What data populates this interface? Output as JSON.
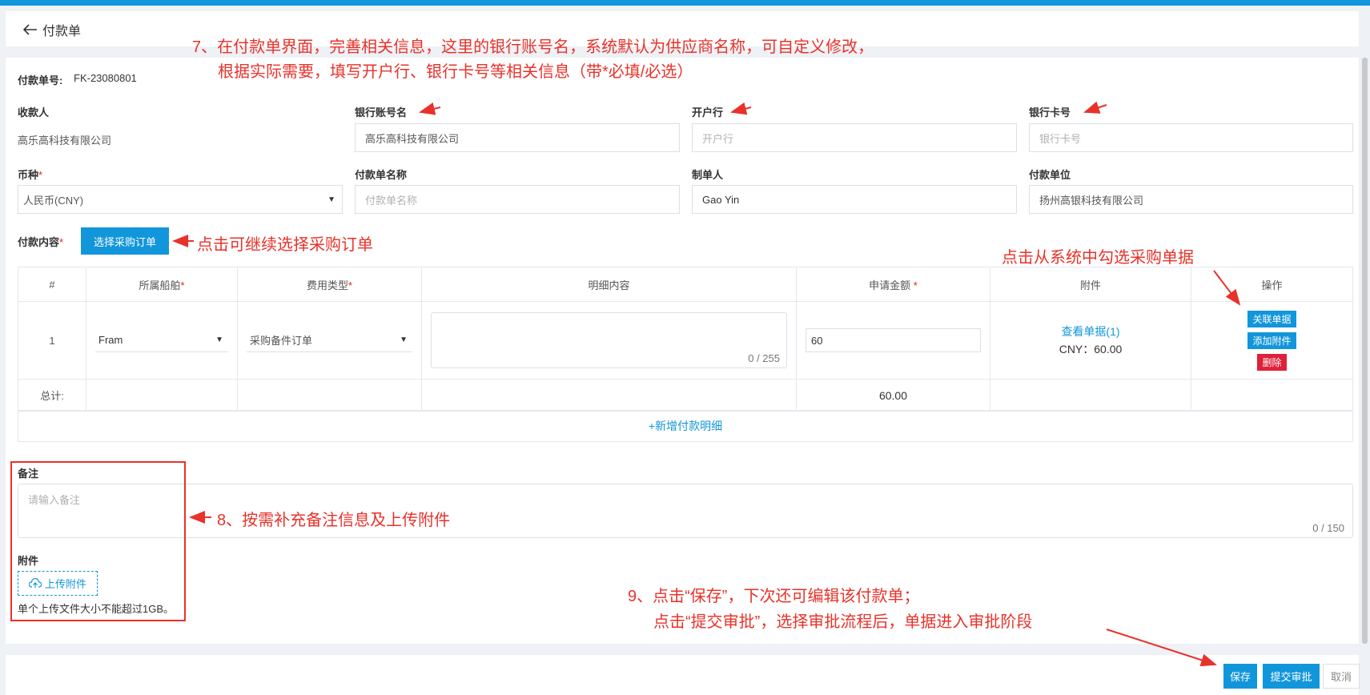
{
  "header": {
    "back_label": "付款单"
  },
  "form": {
    "order_no_label": "付款单号:",
    "order_no_value": "FK-23080801",
    "payee_label": "收款人",
    "payee_value": "高乐高科技有限公司",
    "bank_account_name_label": "银行账号名",
    "bank_account_name_value": "高乐高科技有限公司",
    "bank_label": "开户行",
    "bank_placeholder": "开户行",
    "card_label": "银行卡号",
    "card_placeholder": "银行卡号",
    "currency_label": "币种",
    "currency_value": "人民币(CNY)",
    "name_label": "付款单名称",
    "name_placeholder": "付款单名称",
    "maker_label": "制单人",
    "maker_value": "Gao Yin",
    "payer_label": "付款单位",
    "payer_value": "扬州高银科技有限公司",
    "content_label": "付款内容",
    "select_po_button": "选择采购订单",
    "required_mark": "*"
  },
  "table": {
    "headers": [
      "#",
      "所属船舶",
      "费用类型",
      "明细内容",
      "申请金额",
      "附件",
      "操作"
    ],
    "row": {
      "index": "1",
      "vessel": "Fram",
      "fee_type": "采购备件订单",
      "detail_counter": "0 / 255",
      "amount": "60",
      "attachment_link": "查看单据(1)",
      "attachment_amount": "CNY：60.00",
      "op_link": "关联单据",
      "op_add": "添加附件",
      "op_delete": "删除"
    },
    "total_label": "总计:",
    "total_value": "60.00",
    "add_row": "+新增付款明细"
  },
  "remark": {
    "label": "备注",
    "placeholder": "请输入备注",
    "counter": "0 / 150",
    "attach_label": "附件",
    "upload_button": "上传附件",
    "upload_hint": "单个上传文件大小不能超过1GB。"
  },
  "footer": {
    "save": "保存",
    "submit": "提交审批",
    "cancel": "取消"
  },
  "annotations": {
    "a7_line1": "7、在付款单界面，完善相关信息，这里的银行账号名，系统默认为供应商名称，可自定义修改，",
    "a7_line2": "根据实际需要，填写开户行、银行卡号等相关信息（带*必填/必选）",
    "select_po": "点击可继续选择采购订单",
    "from_system": "点击从系统中勾选采购单据",
    "a8": "8、按需补充备注信息及上传附件",
    "a9_line1": "9、点击“保存”，下次还可编辑该付款单；",
    "a9_line2": "点击“提交审批”，选择审批流程后，单据进入审批阶段"
  },
  "colors": {
    "accent": "#1296db",
    "annotation": "#e8322a",
    "danger": "#e0203a"
  }
}
